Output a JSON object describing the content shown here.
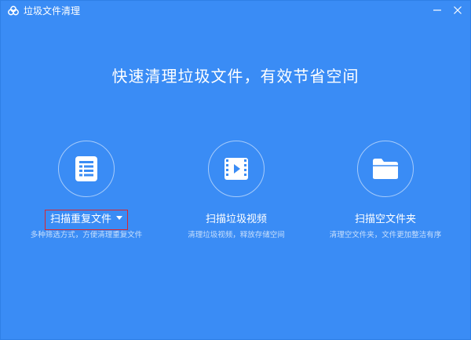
{
  "window": {
    "title": "垃圾文件清理",
    "app_icon": "cloud-icon",
    "controls": {
      "minimize_icon": "minimize-icon",
      "close_icon": "close-icon"
    }
  },
  "headline": "快速清理垃圾文件，有效节省空间",
  "features": [
    {
      "icon": "document-list-icon",
      "label": "扫描重复文件",
      "has_dropdown": true,
      "description": "多种筛选方式，方便清理重复文件"
    },
    {
      "icon": "video-film-icon",
      "label": "扫描垃圾视频",
      "has_dropdown": false,
      "description": "清理垃圾视频，释放存储空间"
    },
    {
      "icon": "folder-icon",
      "label": "扫描空文件夹",
      "has_dropdown": false,
      "description": "清理空文件夹，文件更加整洁有序"
    }
  ],
  "colors": {
    "background": "#3a8cf5",
    "highlight_border": "#d9262f",
    "text": "#ffffff"
  }
}
